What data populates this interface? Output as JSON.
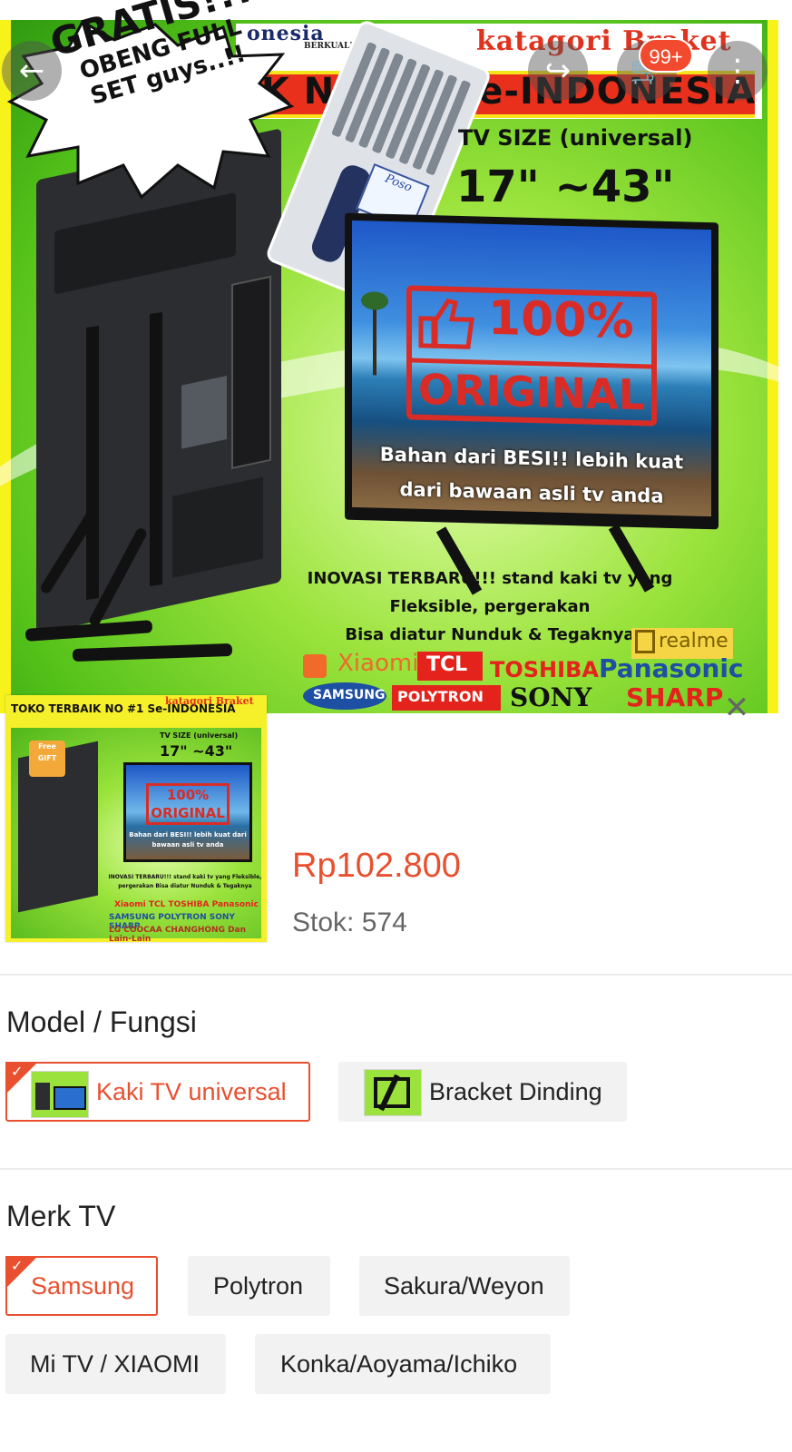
{
  "banner": {
    "shop_name": "onesia",
    "shop_sub": "BERKUALIT",
    "kategori": "katagori Braket",
    "headline": "IK NO #1 Se-INDONESIA",
    "gratis_line1": "GRATIS!!!",
    "gratis_line2": "OBENG FULL",
    "gratis_line3": "SET guys..!!",
    "screwdriver_brand": "Poso",
    "tv_size_label": "TV SIZE (universal)",
    "tv_size_range": "17\" ~43\"",
    "original_pct": "100%",
    "original_word": "ORIGINAL",
    "bahan_line1": "Bahan dari BESI!! lebih kuat",
    "bahan_line2": "dari bawaan asli tv anda",
    "inovasi_line1": "INOVASI TERBARU!!! stand kaki tv yang",
    "inovasi_line2": "Fleksible, pergerakan",
    "inovasi_line3": "Bisa diatur Nunduk & Tegaknya",
    "brands": {
      "realme": "realme",
      "xiaomi": "Xiaomi",
      "tcl": "TCL",
      "toshiba": "TOSHIBA",
      "panasonic": "Panasonic",
      "samsung": "SAMSUNG",
      "polytron": "POLYTRON",
      "sony": "SONY",
      "sharp": "SHARP"
    },
    "colors": {
      "frame": "#f7f21a",
      "red": "#e8301c",
      "green": "#6cd12a"
    }
  },
  "nav": {
    "back_icon": "←",
    "share_icon": "↪",
    "cart_icon": "🛒",
    "cart_badge": "99+",
    "more_icon": "⋮"
  },
  "thumbnail": {
    "title": "TOKO TERBAIK NO #1 Se-INDONESIA",
    "kategori": "katagori Braket",
    "tv_size": "TV SIZE (universal)",
    "range": "17\" ~43\"",
    "box": "100% ORIGINAL",
    "bahan": "Bahan dari BESI!! lebih kuat dari bawaan asli tv anda",
    "gift": "Free GIFT",
    "inovasi": "INOVASI TERBARU!!! stand kaki tv yang Fleksible, pergerakan Bisa diatur Nunduk & Tegaknya",
    "brands_row1": "Xiaomi TCL TOSHIBA Panasonic",
    "brands_row2": "SAMSUNG POLYTRON SONY SHARP",
    "brands_row3": "LG COOCAA CHANGHONG Dan Lain-Lain"
  },
  "product": {
    "price": "Rp102.800",
    "stock": "Stok: 574",
    "close_icon": "✕",
    "accent": "#e8502f"
  },
  "variants": {
    "model_title": "Model / Fungsi",
    "models": [
      {
        "label": "Kaki TV universal",
        "selected": true
      },
      {
        "label": "Bracket Dinding",
        "selected": false
      }
    ],
    "brand_title": "Merk TV",
    "brands": [
      {
        "label": "Samsung",
        "selected": true
      },
      {
        "label": "Polytron",
        "selected": false
      },
      {
        "label": "Sakura/Weyon",
        "selected": false
      },
      {
        "label": "Mi TV / XIAOMI",
        "selected": false
      },
      {
        "label": "Konka/Aoyama/Ichiko",
        "selected": false
      }
    ],
    "check_icon": "✓"
  }
}
